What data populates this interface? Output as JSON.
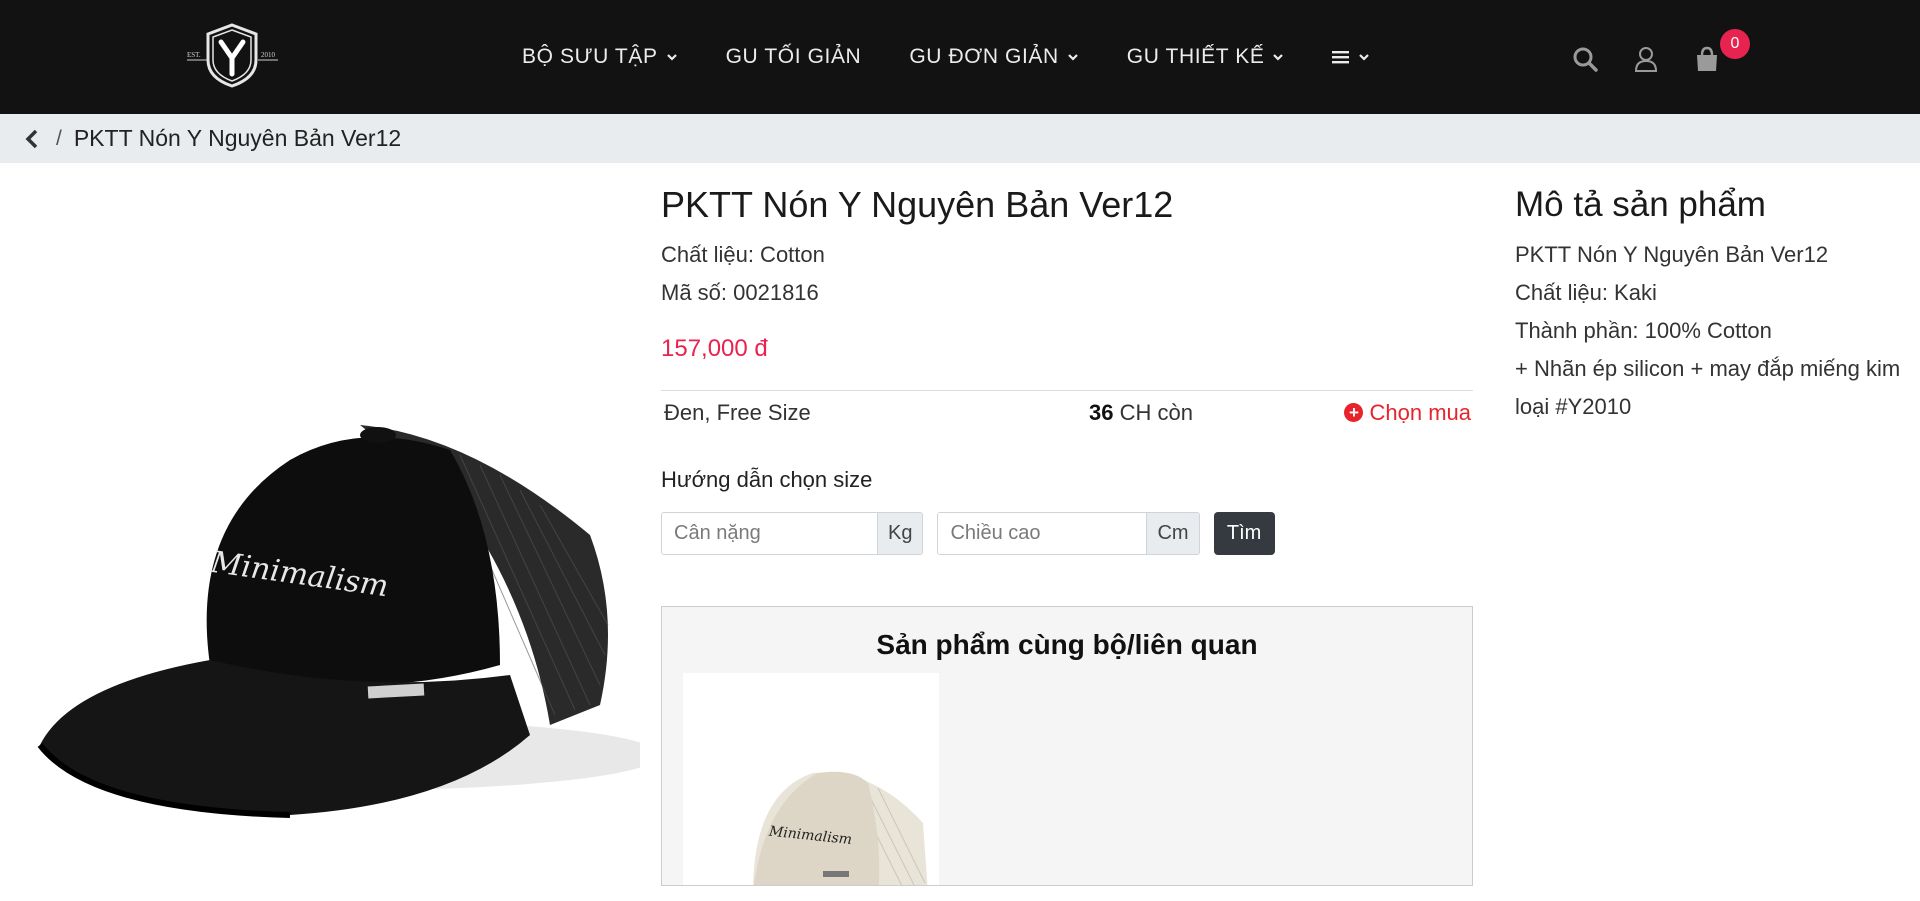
{
  "header": {
    "logo_alt": "Y",
    "logo_est_left": "EST.",
    "logo_est_right": "2010",
    "nav": [
      {
        "label": "BỘ SƯU TẬP",
        "has_dropdown": true
      },
      {
        "label": "GU TỐI GIẢN",
        "has_dropdown": false
      },
      {
        "label": "GU ĐƠN GIẢN",
        "has_dropdown": true
      },
      {
        "label": "GU THIẾT KẾ",
        "has_dropdown": true
      }
    ],
    "menu_icon": "hamburger-icon",
    "icons": [
      "search-icon",
      "user-icon",
      "shopping-bag-icon"
    ],
    "cart_count": "0",
    "accent_color": "#e8234f"
  },
  "breadcrumb": {
    "back_icon": "chevron-left-icon",
    "separator": "/",
    "current": "PKTT Nón Y Nguyên Bản Ver12"
  },
  "product": {
    "title": "PKTT Nón Y Nguyên Bản Ver12",
    "material": "Chất liệu: Cotton",
    "code": "Mã số: 0021816",
    "price": "157,000 đ",
    "variant": {
      "name": "Đen, Free Size",
      "stock_count": "36",
      "stock_suffix": "CH còn",
      "buy_label": "Chọn mua"
    },
    "image_text": "Minimalism"
  },
  "size_guide": {
    "title": "Hướng dẫn chọn size",
    "weight_placeholder": "Cân nặng",
    "weight_unit": "Kg",
    "height_placeholder": "Chiều cao",
    "height_unit": "Cm",
    "button": "Tìm"
  },
  "related": {
    "title": "Sản phẩm cùng bộ/liên quan",
    "item_image_text": "Minimalism"
  },
  "description": {
    "title": "Mô tả sản phẩm",
    "lines": [
      "PKTT Nón Y Nguyên Bản Ver12",
      "Chất liệu: Kaki",
      "Thành phần: 100% Cotton",
      "+ Nhãn ép silicon + may đắp miếng kim",
      "loại #Y2010"
    ]
  }
}
